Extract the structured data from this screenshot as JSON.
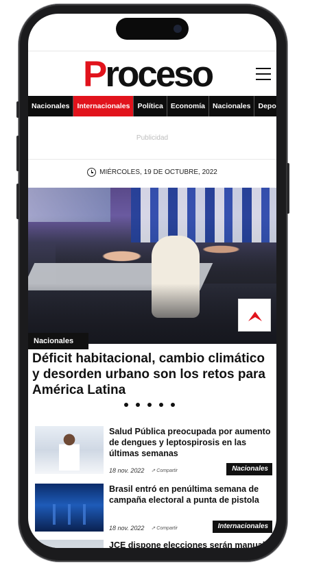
{
  "site": {
    "logo_first": "P",
    "logo_rest": "roceso"
  },
  "nav": [
    {
      "label": "Nacionales",
      "active": false
    },
    {
      "label": "Internacionales",
      "active": true
    },
    {
      "label": "Política",
      "active": false
    },
    {
      "label": "Economía",
      "active": false
    },
    {
      "label": "Nacionales",
      "active": false
    },
    {
      "label": "Deportes",
      "active": false
    }
  ],
  "ad_label": "Publicidad",
  "date": "MIÉRCOLES, 19 DE OCTUBRE, 2022",
  "featured": {
    "category": "Nacionales",
    "headline": "Déficit habitacional, cambio climático y desorden urbano son los retos para América Latina"
  },
  "articles": [
    {
      "title": "Salud Pública preocupada por aumento de dengues y leptospirosis en las últimas semanas",
      "date": "18 nov. 2022",
      "share": "Compartir",
      "category": "Nacionales"
    },
    {
      "title": "Brasil entró en penúltima semana de campaña electoral a punta de pistola",
      "date": "18 nov. 2022",
      "share": "Compartir",
      "category": "Internacionales"
    },
    {
      "title": "JCE dispone elecciones serán manual",
      "date": "",
      "share": "",
      "category": ""
    }
  ],
  "colors": {
    "brand_red": "#e1131c",
    "nav_bg": "#0d0d0d"
  },
  "icons": [
    "menu-icon",
    "clock-icon",
    "bookmark-icon",
    "share-icon"
  ]
}
